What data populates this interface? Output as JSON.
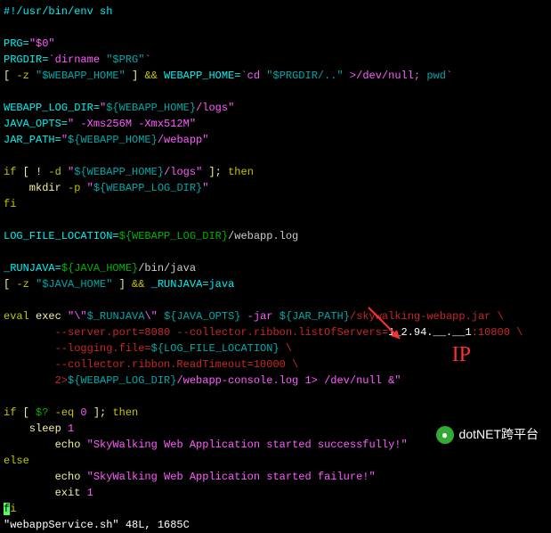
{
  "l1": "#!/usr/bin/env sh",
  "l3a": "PRG=",
  "l3b": "\"$0\"",
  "l4a": "PRGDIR=",
  "l4b": "`dirname ",
  "l4c": "\"$PRG\"",
  "l4d": "`",
  "l5a": "[ ",
  "l5b": "-z",
  "l5c": " \"$WEBAPP_HOME\"",
  "l5d": " ] ",
  "l5e": "&&",
  "l5f": " WEBAPP_HOME=",
  "l5g": "`cd ",
  "l5h": "\"$PRGDIR/..\"",
  "l5i": " >/dev/null; ",
  "l5j": "pwd",
  "l5k": "`",
  "l7a": "WEBAPP_LOG_DIR=",
  "l7b": "\"${WEBAPP_HOME}/logs\"",
  "l8a": "JAVA_OPTS=",
  "l8b": "\" -Xms256M -Xmx512M\"",
  "l9a": "JAR_PATH=",
  "l9b": "\"${WEBAPP_HOME}/webapp\"",
  "l11a": "if",
  "l11b": " [ ! ",
  "l11c": "-d",
  "l11d": " \"${WEBAPP_HOME}/logs\"",
  "l11e": " ]; ",
  "l11f": "then",
  "l12a": "    mkdir ",
  "l12b": "-p",
  "l12c": " \"${WEBAPP_LOG_DIR}\"",
  "l13": "fi",
  "l15a": "LOG_FILE_LOCATION=",
  "l15b": "${WEBAPP_LOG_DIR}",
  "l15c": "/webapp.log",
  "l17a": "_RUNJAVA=",
  "l17b": "${JAVA_HOME}",
  "l17c": "/bin/java",
  "l18a": "[ ",
  "l18b": "-z",
  "l18c": " \"$JAVA_HOME\"",
  "l18d": " ] ",
  "l18e": "&&",
  "l18f": " _RUNJAVA=java",
  "l20a": "eval",
  "l20b": " exec ",
  "l20c": "\"\\\"$_RUNJAVA\\\" ${JAVA_OPTS} -jar ${JAR_PATH}",
  "l20d": "/skywalking-webapp.jar \\",
  "l21a": "        --server.port=8080 --collector.ribbon.listOfServers=",
  "l21b": "1_2.94.__.__1",
  "l21c": ":10800 \\",
  "l22": "        --logging.file=${LOG_FILE_LOCATION} \\",
  "l23": "        --collector.ribbon.ReadTimeout=10000 \\",
  "l24a": "        2>${WEBAPP_LOG_DIR}",
  "l24b": "/webapp-console.log 1> /dev/null &",
  "l24c": "\"",
  "l26a": "if",
  "l26b": " [ ",
  "l26c": "$?",
  "l26d": " -eq",
  "l26e": " 0",
  "l26f": " ]; ",
  "l26g": "then",
  "l27a": "    sleep ",
  "l27b": "1",
  "l28a": "        echo ",
  "l28b": "\"SkyWalking Web Application started successfully!\"",
  "l29": "else",
  "l30a": "        echo ",
  "l30b": "\"SkyWalking Web Application started failure!\"",
  "l31a": "        exit ",
  "l31b": "1",
  "l32": "fi",
  "status": "\"webappService.sh\" 48L, 1685C",
  "annotation": "IP",
  "footer": "dotNET跨平台",
  "footer_icon": "●"
}
